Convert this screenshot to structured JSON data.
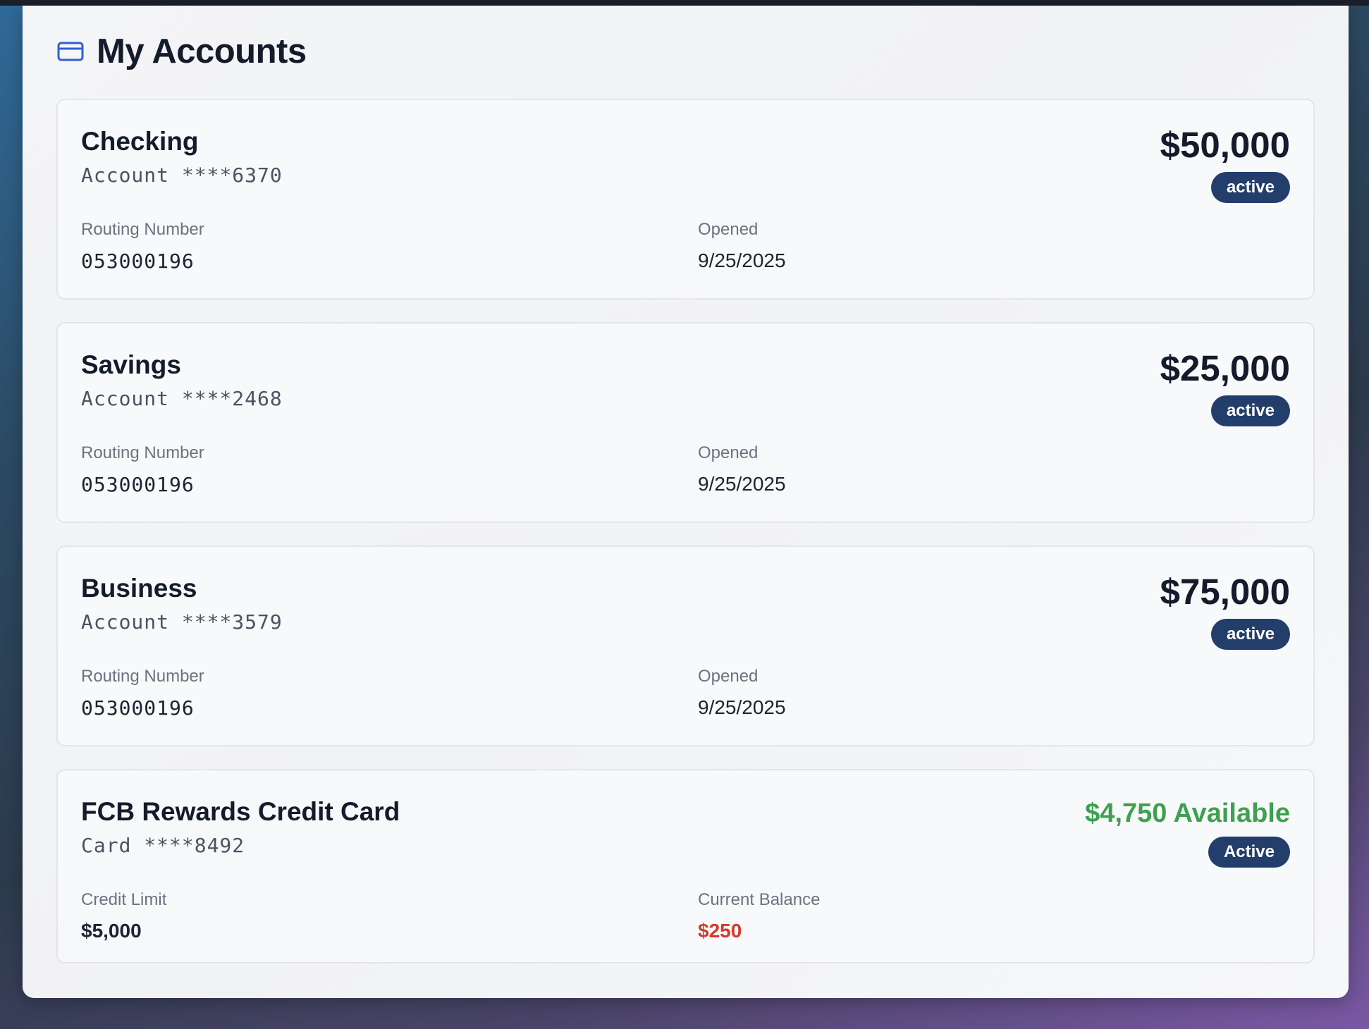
{
  "header": {
    "title": "My Accounts",
    "icon": "credit-card-icon",
    "accent": "#2f5fd0"
  },
  "accounts": [
    {
      "name": "Checking",
      "number": "Account ****6370",
      "balance": "$50,000",
      "status": "active",
      "field1_label": "Routing Number",
      "field1_value": "053000196",
      "field2_label": "Opened",
      "field2_value": "9/25/2025"
    },
    {
      "name": "Savings",
      "number": "Account ****2468",
      "balance": "$25,000",
      "status": "active",
      "field1_label": "Routing Number",
      "field1_value": "053000196",
      "field2_label": "Opened",
      "field2_value": "9/25/2025"
    },
    {
      "name": "Business",
      "number": "Account ****3579",
      "balance": "$75,000",
      "status": "active",
      "field1_label": "Routing Number",
      "field1_value": "053000196",
      "field2_label": "Opened",
      "field2_value": "9/25/2025"
    }
  ],
  "credit_card": {
    "name": "FCB Rewards Credit Card",
    "number": "Card ****8492",
    "available": "$4,750 Available",
    "status": "Active",
    "limit_label": "Credit Limit",
    "limit_value": "$5,000",
    "balance_label": "Current Balance",
    "balance_value": "$250"
  },
  "colors": {
    "badge": "#233e6b",
    "available": "#3ea050",
    "balance_due": "#d33a2c"
  }
}
